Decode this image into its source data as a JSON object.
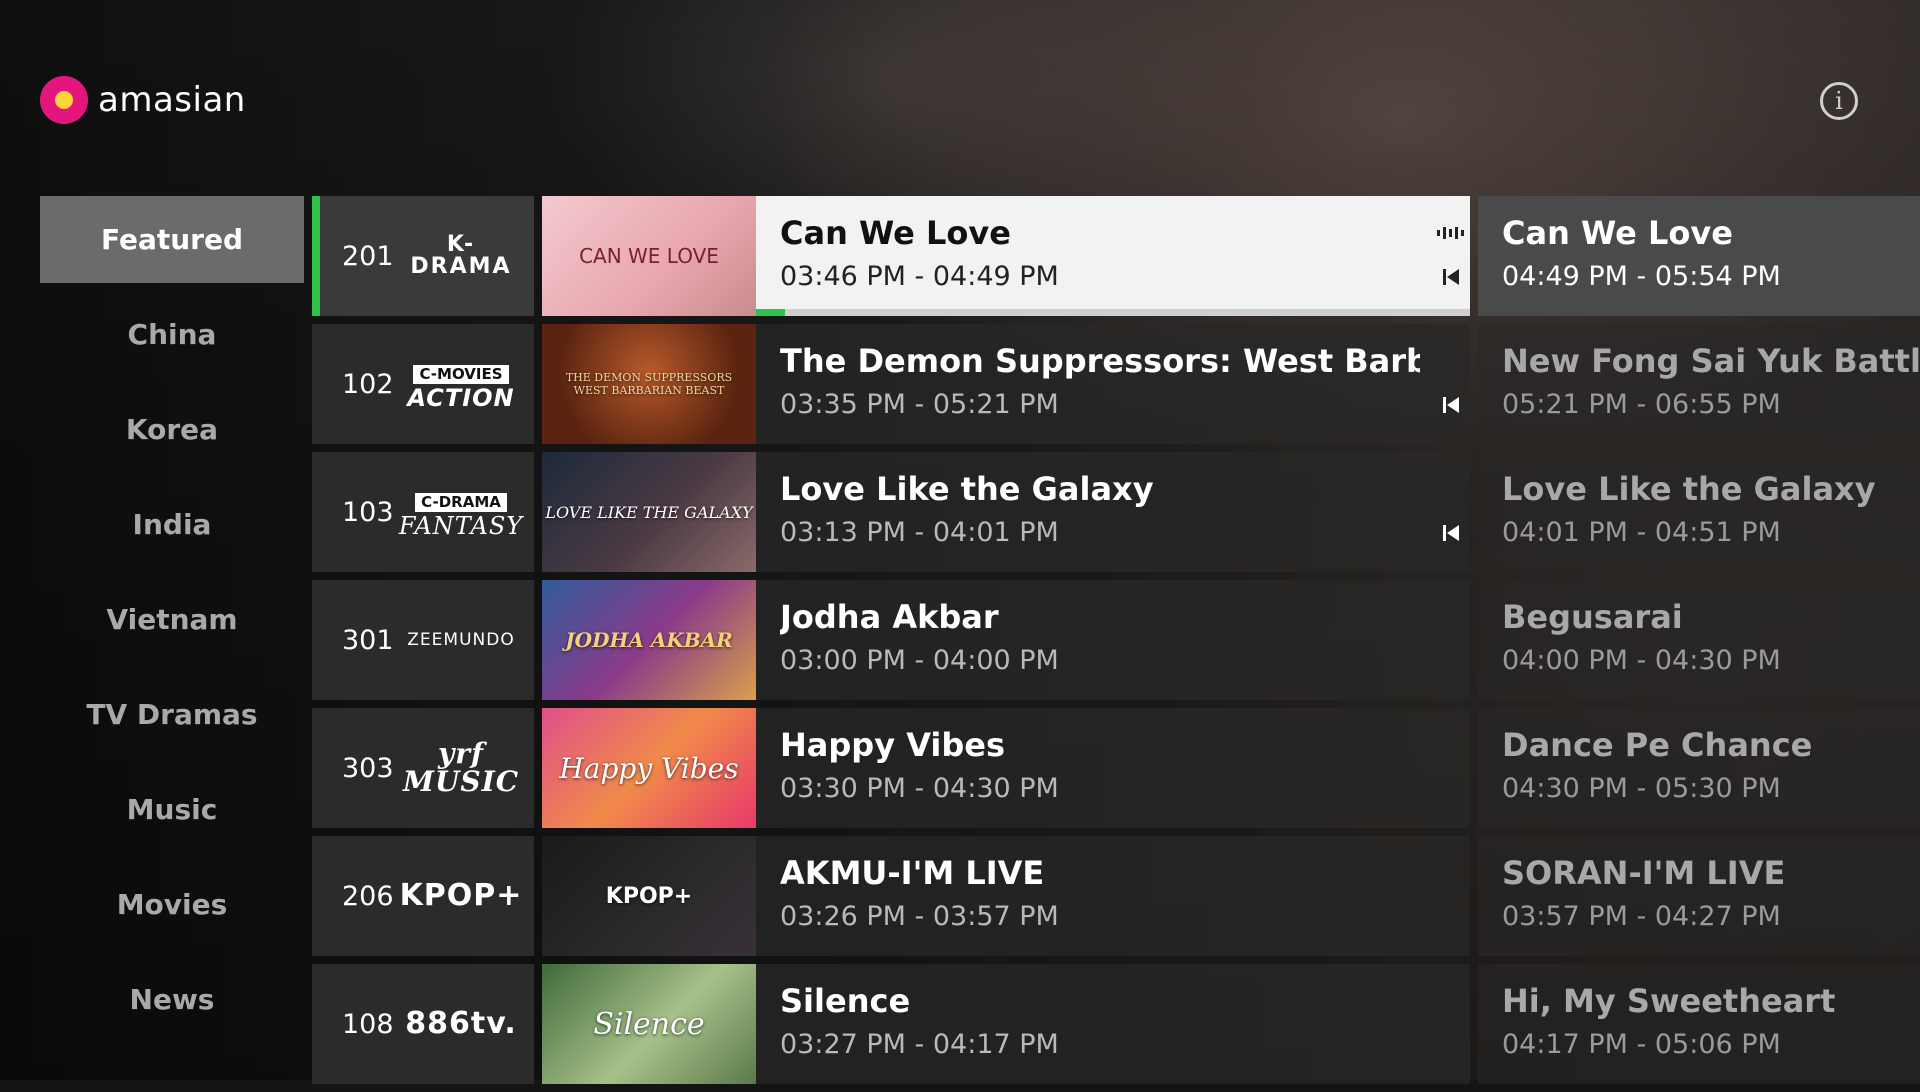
{
  "brand": {
    "name": "amasian",
    "accent": "#e5157f",
    "dot": "#ffd43b"
  },
  "header": {
    "info_icon": "info-icon"
  },
  "sidebar": {
    "items": [
      {
        "label": "Featured",
        "active": true
      },
      {
        "label": "China"
      },
      {
        "label": "Korea"
      },
      {
        "label": "India"
      },
      {
        "label": "Vietnam"
      },
      {
        "label": "TV Dramas"
      },
      {
        "label": "Music"
      },
      {
        "label": "Movies"
      },
      {
        "label": "News"
      }
    ]
  },
  "guide": {
    "rows": [
      {
        "channel": "201",
        "logo_main": "K-DRAMA",
        "logo_tag": "",
        "thumb_text": "CAN WE LOVE",
        "now_title": "Can We Love",
        "now_time": "03:46 PM - 04:49 PM",
        "next_title": "Can We Love",
        "next_time": "04:49 PM - 05:54 PM",
        "progress": 0.04,
        "live": true,
        "restart": true
      },
      {
        "channel": "102",
        "logo_main": "ACTION",
        "logo_tag": "C-MOVIES",
        "thumb_text": "THE DEMON SUPPRESSORS WEST BARBARIAN BEAST",
        "now_title": "The Demon Suppressors: West Barbarian...",
        "now_time": "03:35 PM - 05:21 PM",
        "next_title": "New Fong Sai Yuk Battle In C",
        "next_time": "05:21 PM - 06:55 PM",
        "restart": true
      },
      {
        "channel": "103",
        "logo_main": "FANTASY",
        "logo_tag": "C-DRAMA",
        "thumb_text": "LOVE LIKE THE GALAXY",
        "now_title": "Love Like the Galaxy",
        "now_time": "03:13 PM - 04:01 PM",
        "next_title": "Love Like the Galaxy",
        "next_time": "04:01 PM - 04:51 PM",
        "restart": true
      },
      {
        "channel": "301",
        "logo_main": "ZEEMUNDO",
        "logo_tag": "",
        "thumb_text": "JODHA AKBAR",
        "now_title": "Jodha Akbar",
        "now_time": "03:00 PM - 04:00 PM",
        "next_title": "Begusarai",
        "next_time": "04:00 PM - 04:30 PM"
      },
      {
        "channel": "303",
        "logo_main": "yrf MUSIC",
        "logo_tag": "",
        "thumb_text": "Happy Vibes",
        "now_title": "Happy Vibes",
        "now_time": "03:30 PM - 04:30 PM",
        "next_title": "Dance Pe Chance",
        "next_time": "04:30 PM - 05:30 PM"
      },
      {
        "channel": "206",
        "logo_main": "KPOP+",
        "logo_tag": "",
        "thumb_text": "KPOP+",
        "now_title": "AKMU-I'M LIVE",
        "now_time": "03:26 PM - 03:57 PM",
        "next_title": "SORAN-I'M LIVE",
        "next_time": "03:57 PM - 04:27 PM"
      },
      {
        "channel": "108",
        "logo_main": "886tv.",
        "logo_tag": "",
        "thumb_text": "Silence",
        "now_title": "Silence",
        "now_time": "03:27 PM - 04:17 PM",
        "next_title": "Hi, My Sweetheart",
        "next_time": "04:17 PM - 05:06 PM"
      }
    ]
  }
}
